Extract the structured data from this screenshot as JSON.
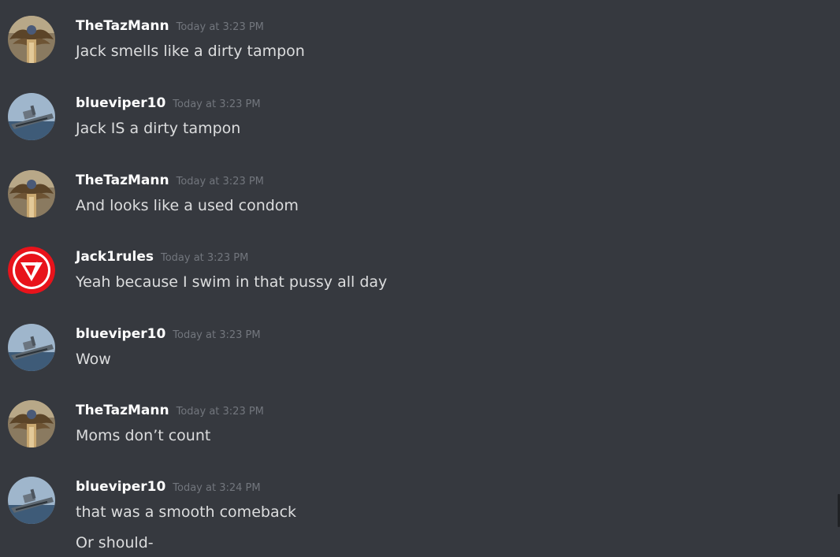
{
  "messages": [
    {
      "author": "TheTazMann",
      "avatar": "eagle-avatar-icon",
      "timestamp": "Today at 3:23 PM",
      "lines": [
        "Jack smells like a dirty tampon"
      ]
    },
    {
      "author": "blueviper10",
      "avatar": "battleship-avatar-icon",
      "timestamp": "Today at 3:23 PM",
      "lines": [
        "Jack IS a dirty tampon"
      ]
    },
    {
      "author": "TheTazMann",
      "avatar": "eagle-avatar-icon",
      "timestamp": "Today at 3:23 PM",
      "lines": [
        "And looks like a used condom"
      ]
    },
    {
      "author": "Jack1rules",
      "avatar": "red-v-logo-avatar-icon",
      "timestamp": "Today at 3:23 PM",
      "lines": [
        "Yeah because I swim in that pussy all day"
      ]
    },
    {
      "author": "blueviper10",
      "avatar": "battleship-avatar-icon",
      "timestamp": "Today at 3:23 PM",
      "lines": [
        "Wow"
      ]
    },
    {
      "author": "TheTazMann",
      "avatar": "eagle-avatar-icon",
      "timestamp": "Today at 3:23 PM",
      "lines": [
        "Moms don’t count"
      ]
    },
    {
      "author": "blueviper10",
      "avatar": "battleship-avatar-icon",
      "timestamp": "Today at 3:24 PM",
      "lines": [
        "that was a smooth comeback",
        "Or should-"
      ]
    }
  ],
  "colors": {
    "background": "#36393f",
    "username": "#ffffff",
    "message_text": "#dcddde",
    "timestamp": "#72767d",
    "jack_logo_red": "#e8131b"
  }
}
